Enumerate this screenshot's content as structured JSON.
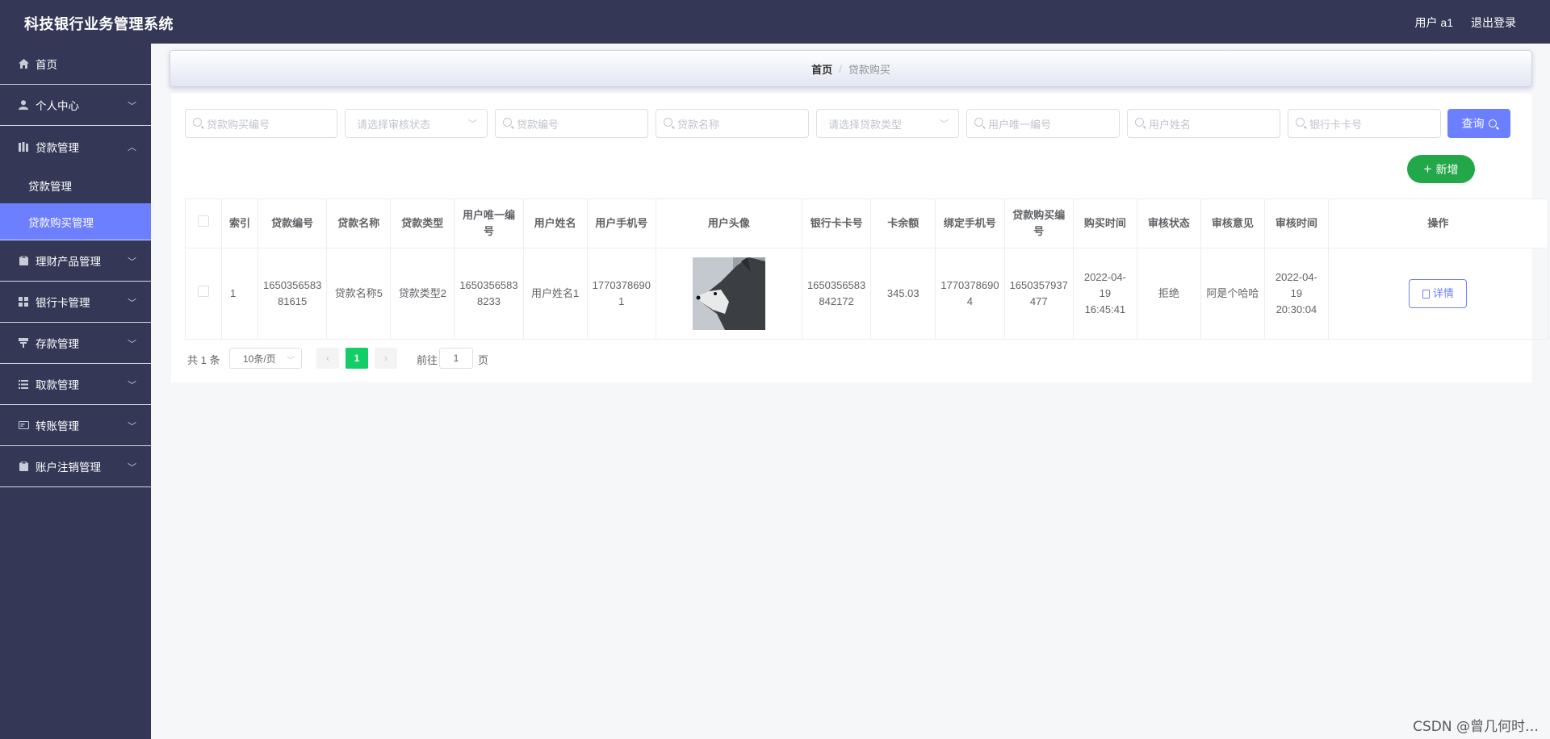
{
  "header": {
    "app_title": "科技银行业务管理系统",
    "user_label": "用户 a1",
    "logout_label": "退出登录"
  },
  "sidebar": {
    "items": [
      {
        "label": "首页",
        "icon": "home-icon",
        "has_arrow": false
      },
      {
        "label": "个人中心",
        "icon": "user-icon",
        "has_arrow": true
      },
      {
        "label": "贷款管理",
        "icon": "loan-icon",
        "has_arrow": true,
        "open": true,
        "children": [
          {
            "label": "贷款管理",
            "active": false
          },
          {
            "label": "贷款购买管理",
            "active": true
          }
        ]
      },
      {
        "label": "理财产品管理",
        "icon": "clipboard-icon",
        "has_arrow": true
      },
      {
        "label": "银行卡管理",
        "icon": "grid-icon",
        "has_arrow": true
      },
      {
        "label": "存款管理",
        "icon": "deposit-icon",
        "has_arrow": true
      },
      {
        "label": "取款管理",
        "icon": "list-icon",
        "has_arrow": true
      },
      {
        "label": "转账管理",
        "icon": "transfer-icon",
        "has_arrow": true
      },
      {
        "label": "账户注销管理",
        "icon": "clipboard-icon",
        "has_arrow": true
      }
    ]
  },
  "breadcrumb": {
    "home": "首页",
    "separator": "/",
    "current": "贷款购买"
  },
  "search": {
    "fields": [
      {
        "placeholder": "贷款购买编号",
        "type": "input"
      },
      {
        "placeholder": "请选择审核状态",
        "type": "select"
      },
      {
        "placeholder": "贷款编号",
        "type": "input"
      },
      {
        "placeholder": "贷款名称",
        "type": "input"
      },
      {
        "placeholder": "请选择贷款类型",
        "type": "select"
      },
      {
        "placeholder": "用户唯一编号",
        "type": "input"
      },
      {
        "placeholder": "用户姓名",
        "type": "input"
      },
      {
        "placeholder": "银行卡卡号",
        "type": "input"
      }
    ],
    "query_label": "查询"
  },
  "actions": {
    "add_label": "新增"
  },
  "table": {
    "columns": [
      "",
      "索引",
      "贷款编号",
      "贷款名称",
      "贷款类型",
      "用户唯一编号",
      "用户姓名",
      "用户手机号",
      "用户头像",
      "银行卡卡号",
      "卡余额",
      "绑定手机号",
      "贷款购买编号",
      "购买时间",
      "审核状态",
      "审核意见",
      "审核时间",
      "操作"
    ],
    "rows": [
      {
        "index": "1",
        "loan_no": "1650356583 81615",
        "loan_name": "贷款名称5",
        "loan_type": "贷款类型2",
        "user_no": "1650356583 8233",
        "user_name": "用户姓名1",
        "user_phone": "1770378690 1",
        "bank_card": "1650356583 842172",
        "balance": "345.03",
        "bound_phone": "1770378690 4",
        "purchase_no": "1650357937 477",
        "purchase_time": "2022-04-19 16:45:41",
        "audit_status": "拒绝",
        "audit_opinion": "阿是个哈哈",
        "audit_time": "2022-04-19 20:30:04",
        "action_label": "详情"
      }
    ]
  },
  "pagination": {
    "total_text": "共 1 条",
    "page_size": "10条/页",
    "current_page": "1",
    "goto_label": "前往",
    "goto_value": "1",
    "page_suffix": "页"
  },
  "watermark": "CSDN @曾几何时…"
}
